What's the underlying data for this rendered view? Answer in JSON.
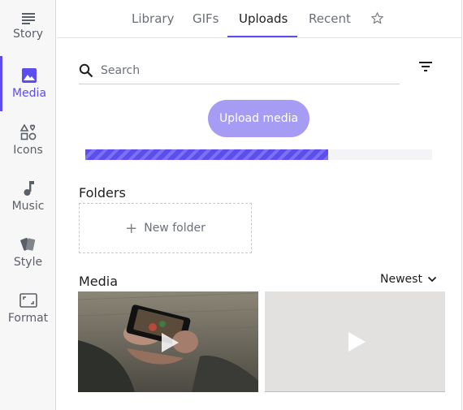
{
  "sidebar": {
    "items": [
      {
        "label": "Story",
        "icon": "story-icon",
        "active": false
      },
      {
        "label": "Media",
        "icon": "image-icon",
        "active": true
      },
      {
        "label": "Icons",
        "icon": "shapes-icon",
        "active": false
      },
      {
        "label": "Music",
        "icon": "music-note-icon",
        "active": false
      },
      {
        "label": "Style",
        "icon": "style-cards-icon",
        "active": false
      },
      {
        "label": "Format",
        "icon": "format-frame-icon",
        "active": false
      }
    ]
  },
  "tabs": {
    "items": [
      {
        "label": "Library"
      },
      {
        "label": "GIFs"
      },
      {
        "label": "Uploads",
        "active": true
      },
      {
        "label": "Recent"
      }
    ],
    "favorite_icon": "star-icon"
  },
  "search": {
    "placeholder": "Search",
    "value": ""
  },
  "upload": {
    "button_label": "Upload media",
    "progress_percent": 70
  },
  "folders": {
    "title": "Folders",
    "new_folder_label": "New folder"
  },
  "media": {
    "title": "Media",
    "sort_label": "Newest"
  },
  "colors": {
    "accent": "#5b4dee",
    "upload_button": "#a79cf3"
  }
}
